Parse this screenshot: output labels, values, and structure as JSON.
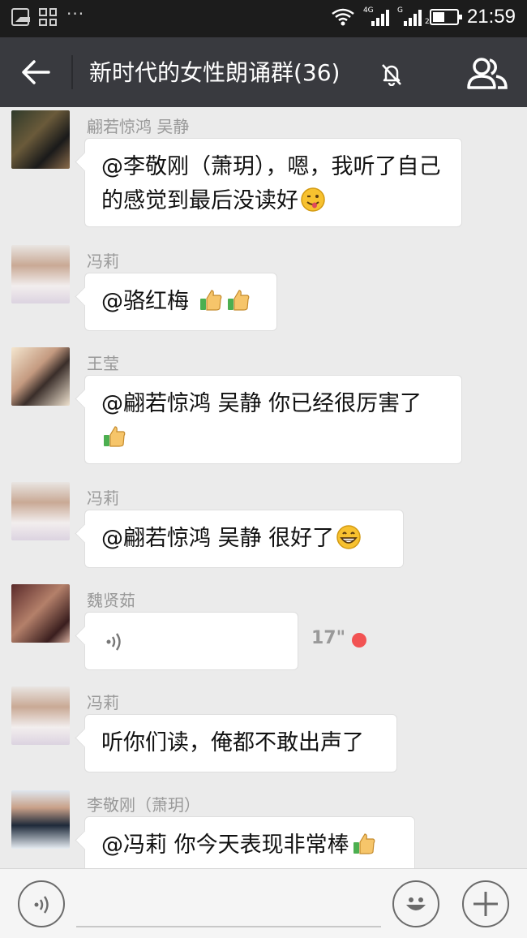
{
  "status_bar": {
    "time": "21:59",
    "network_1": "4G",
    "network_2": "G",
    "sim_2": "2",
    "more": "···"
  },
  "header": {
    "title": "新时代的女性朗诵群(36)",
    "member_count": 36,
    "muted": true
  },
  "messages": [
    {
      "sender": "翩若惊鸿  吴静",
      "text": "@李敬刚（萧玥），嗯，我听了自己的感觉到最后没读好",
      "emojis": [
        "wink-tongue-emoji"
      ]
    },
    {
      "sender": "冯莉",
      "text": "@骆红梅 ",
      "emojis": [
        "thumbs-up-emoji",
        "thumbs-up-emoji"
      ]
    },
    {
      "sender": "王莹",
      "text": "@翩若惊鸿  吴静  你已经很厉害了",
      "emojis": [
        "thumbs-up-emoji"
      ]
    },
    {
      "sender": "冯莉",
      "text": "@翩若惊鸿  吴静  很好了",
      "emojis": [
        "grin-emoji"
      ]
    },
    {
      "sender": "魏贤茹",
      "type": "voice",
      "duration": "17\"",
      "unread": true
    },
    {
      "sender": "冯莉",
      "text": "听你们读，俺都不敢出声了"
    },
    {
      "sender": "李敬刚（萧玥）",
      "text": "@冯莉  你今天表现非常棒",
      "emojis": [
        "thumbs-up-emoji"
      ]
    }
  ],
  "input_bar": {
    "voice_icon": "voice-icon",
    "emoji_icon": "smiley-icon",
    "plus_icon": "plus-icon"
  },
  "colors": {
    "title_bar": "#393a3f",
    "status_bar": "#1c1c1c",
    "chat_bg": "#ebebeb",
    "unread": "#f25353"
  }
}
